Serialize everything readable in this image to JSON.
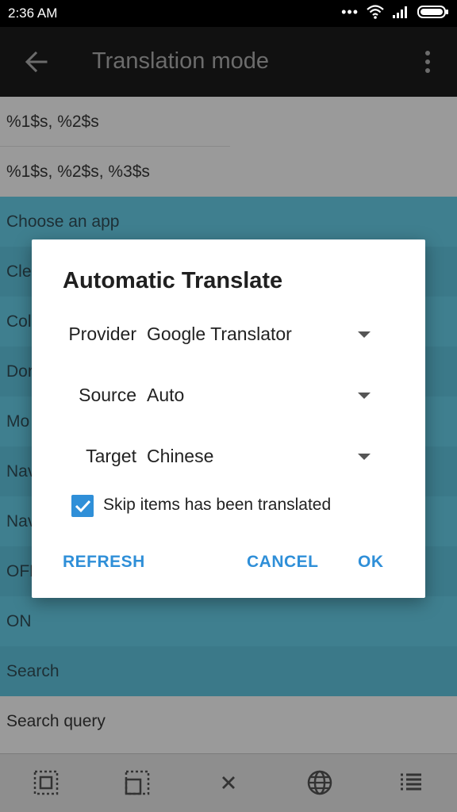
{
  "status_bar": {
    "time": "2:36  AM",
    "icons": [
      "more-dots-icon",
      "wifi-icon",
      "signal-icon",
      "battery-icon"
    ]
  },
  "app_bar": {
    "title": "Translation mode",
    "back_icon": "arrow-left-icon",
    "menu_icon": "more-vertical-icon"
  },
  "list": {
    "items": [
      "%1$s, %2$s",
      "%1$s, %2$s, %3$s",
      "Choose an app",
      "Cle",
      "Col",
      "Dor",
      "Mo",
      "Nav",
      "Nav",
      "OFF",
      "ON",
      "Search",
      "Search query"
    ]
  },
  "dialog": {
    "title": "Automatic Translate",
    "provider": {
      "label": "Provider",
      "value": "Google Translator"
    },
    "source": {
      "label": "Source",
      "value": "Auto"
    },
    "target": {
      "label": "Target",
      "value": "Chinese"
    },
    "skip_translated": {
      "label": "Skip items has been translated",
      "checked": true
    },
    "buttons": {
      "refresh": "REFRESH",
      "cancel": "CANCEL",
      "ok": "OK"
    }
  },
  "toolbar": {
    "icons": [
      "select-all-icon",
      "select-partial-icon",
      "close-icon",
      "globe-icon",
      "list-icon"
    ]
  },
  "colors": {
    "accent": "#2f8fd8",
    "list_selected": "#3f7f8f",
    "scrim": "#9a9a9a",
    "app_bar": "#111111"
  }
}
